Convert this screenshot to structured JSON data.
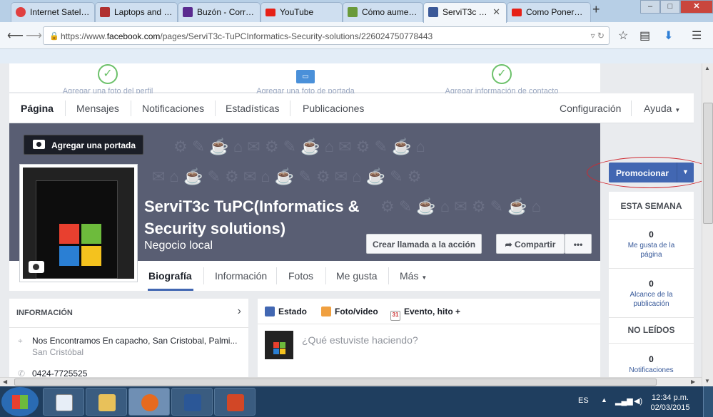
{
  "browser": {
    "tabs": [
      {
        "label": "Internet Satel…",
        "icon_color": "#e04040"
      },
      {
        "label": "Laptops and …",
        "icon_color": "#b03030"
      },
      {
        "label": "Buzón - Corr…",
        "icon_color": "#5a2a8f"
      },
      {
        "label": "YouTube",
        "icon_color": "#e62117"
      },
      {
        "label": "Cómo aume…",
        "icon_color": "#6a9a3a"
      },
      {
        "label": "ServiT3c …",
        "icon_color": "#3b5998"
      },
      {
        "label": "Como Poner…",
        "icon_color": "#e62117"
      }
    ],
    "new_tab": "+",
    "url_prefix": "https://www.",
    "url_domain": "facebook.com",
    "url_path": "/pages/ServiT3c-TuPCInformatics-Security-solutions/226024750778443"
  },
  "setup_steps": [
    {
      "label": "Agregar una foto del perfil"
    },
    {
      "label": "Agregar una foto de portada"
    },
    {
      "label": "Agregar información de contacto"
    }
  ],
  "page_nav": {
    "items": [
      "Página",
      "Mensajes",
      "Notificaciones",
      "Estadísticas",
      "Publicaciones"
    ],
    "config": "Configuración",
    "help": "Ayuda"
  },
  "cover": {
    "add_cover": "Agregar una portada",
    "title": "ServiT3c TuPC(Informatics & Security solutions)",
    "category": "Negocio local",
    "cta": "Crear llamada a la acción",
    "share": "Compartir",
    "more": "•••"
  },
  "timeline_tabs": [
    "Biografía",
    "Información",
    "Fotos",
    "Me gusta",
    "Más"
  ],
  "info_box": {
    "header": "INFORMACIÓN",
    "address": "Nos Encontramos En capacho, San Cristobal, Palmi...",
    "city": "San Cristóbal",
    "phone": "0424-7725525"
  },
  "composer": {
    "tabs": [
      "Estado",
      "Foto/video",
      "Evento, hito +"
    ],
    "event_icon_text": "31",
    "placeholder": "¿Qué estuviste haciendo?"
  },
  "right_panel": {
    "promote": "Promocionar",
    "this_week": "ESTA SEMANA",
    "likes_count": "0",
    "likes_label": "Me gusta de la página",
    "reach_count": "0",
    "reach_label": "Alcance de la publicación",
    "unread": "NO LEÍDOS",
    "notif_count": "0",
    "notif_label": "Notificaciones"
  },
  "taskbar": {
    "lang": "ES",
    "time": "12:34 p.m.",
    "date": "02/03/2015"
  },
  "colors": {
    "facebook_blue": "#4267b2",
    "cover_bg": "#595e73",
    "highlight_ring": "#d0282f"
  }
}
